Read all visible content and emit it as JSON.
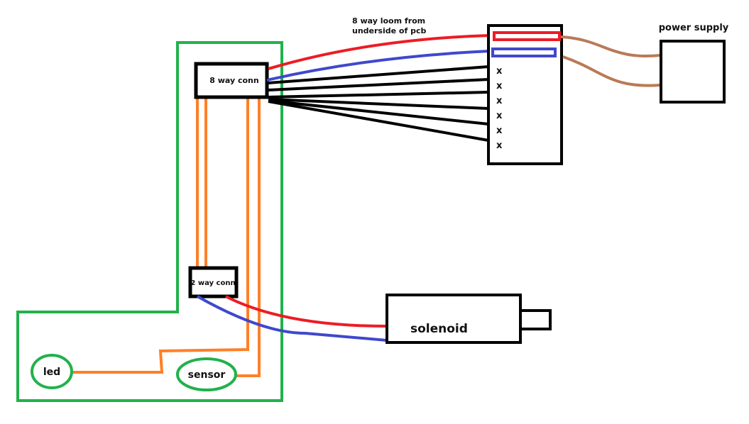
{
  "labels": {
    "eight_way_conn": "8 way conn",
    "two_way_conn": "2 way conn",
    "loom_line1": "8 way loom from",
    "loom_line2": "underside of pcb",
    "power_supply": "power supply",
    "solenoid": "solenoid",
    "led": "led",
    "sensor": "sensor",
    "unused_pin_marks": [
      "x",
      "x",
      "x",
      "x",
      "x",
      "x"
    ]
  },
  "colors": {
    "board_outline": "#22b14c",
    "wire_positive": "#ed1c24",
    "wire_negative": "#3f48cc",
    "wire_signal": "#ff7f27",
    "wire_loom": "#000000",
    "wire_power": "#b97a57",
    "box_outline": "#000000"
  }
}
